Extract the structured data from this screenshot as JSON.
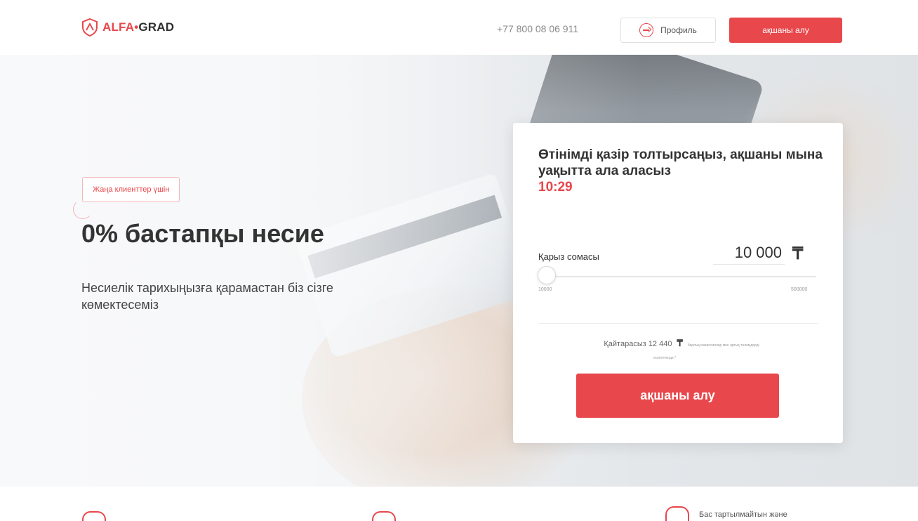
{
  "header": {
    "logo_alfa": "ALFA",
    "logo_dot": "•",
    "logo_grad": "GRAD",
    "phone": "+77 800 08 06 911",
    "profile_label": "Профиль",
    "cta_label": "ақшаны алу"
  },
  "hero": {
    "badge": "Жаңа клиенттер үшін",
    "title": "0% бастапқы несие",
    "subtitle": "Несиелік тарихыңызға қарамастан біз сізге көмектесеміз"
  },
  "form": {
    "title": "Өтінімді қазір толтырсаңыз, ақшаны мына уақытта ала аласыз",
    "timer": "10:29",
    "amount_label": "Қарыз сомасы",
    "amount_value": "10 000",
    "currency_symbol": "₸",
    "slider_min": "10000",
    "slider_max": "500000",
    "slider_fraction": 0.0,
    "return_text": "Қайтарасыз 12 440",
    "return_note": "барлық комиссиялар мен артық төлемдерді",
    "return_note2": "есептегенде.*",
    "cta_label": "ақшаны алу"
  },
  "bottom": {
    "item3": "Бас тартылмайтын және"
  },
  "colors": {
    "accent": "#e8474b",
    "text": "#333333"
  }
}
